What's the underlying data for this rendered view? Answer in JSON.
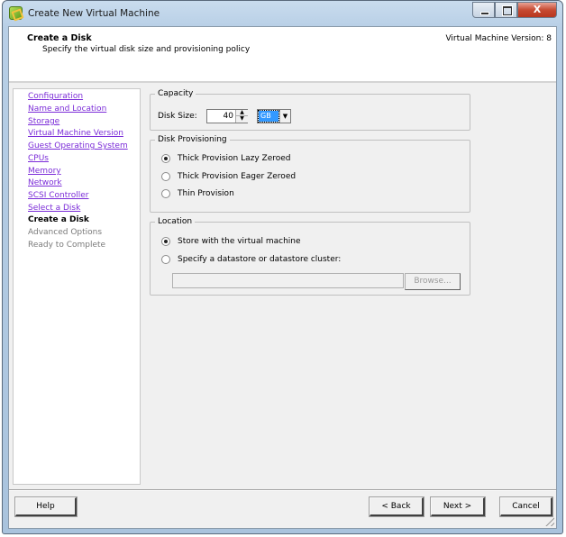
{
  "window": {
    "title": "Create New Virtual Machine",
    "icon": "vsphere-app-icon",
    "controls": {
      "minimize": "minimize-icon",
      "maximize": "maximize-icon",
      "close_glyph": "X"
    }
  },
  "header": {
    "title": "Create a Disk",
    "subtitle": "Specify the virtual disk size and provisioning policy",
    "version": "Virtual Machine Version: 8"
  },
  "nav": {
    "items": [
      {
        "label": "Configuration",
        "state": "visited"
      },
      {
        "label": "Name and Location",
        "state": "visited"
      },
      {
        "label": "Storage",
        "state": "visited"
      },
      {
        "label": "Virtual Machine Version",
        "state": "visited"
      },
      {
        "label": "Guest Operating System",
        "state": "visited"
      },
      {
        "label": "CPUs",
        "state": "visited"
      },
      {
        "label": "Memory",
        "state": "visited"
      },
      {
        "label": "Network",
        "state": "visited"
      },
      {
        "label": "SCSI Controller",
        "state": "visited"
      },
      {
        "label": "Select a Disk",
        "state": "visited"
      },
      {
        "label": "Create a Disk",
        "state": "current"
      },
      {
        "label": "Advanced Options",
        "state": "future"
      },
      {
        "label": "Ready to Complete",
        "state": "future"
      }
    ]
  },
  "capacity": {
    "legend": "Capacity",
    "disk_size_label": "Disk Size:",
    "disk_size_value": "40",
    "unit_value": "GB"
  },
  "provisioning": {
    "legend": "Disk Provisioning",
    "options": [
      {
        "label": "Thick Provision Lazy Zeroed",
        "checked": true
      },
      {
        "label": "Thick Provision Eager Zeroed",
        "checked": false
      },
      {
        "label": "Thin Provision",
        "checked": false
      }
    ]
  },
  "location": {
    "legend": "Location",
    "options": [
      {
        "label": "Store with the virtual machine",
        "checked": true
      },
      {
        "label": "Specify a datastore or datastore cluster:",
        "checked": false
      }
    ],
    "datastore_value": "",
    "browse_label": "Browse..."
  },
  "footer": {
    "help": "Help",
    "back": "< Back",
    "next": "Next >",
    "cancel": "Cancel"
  }
}
